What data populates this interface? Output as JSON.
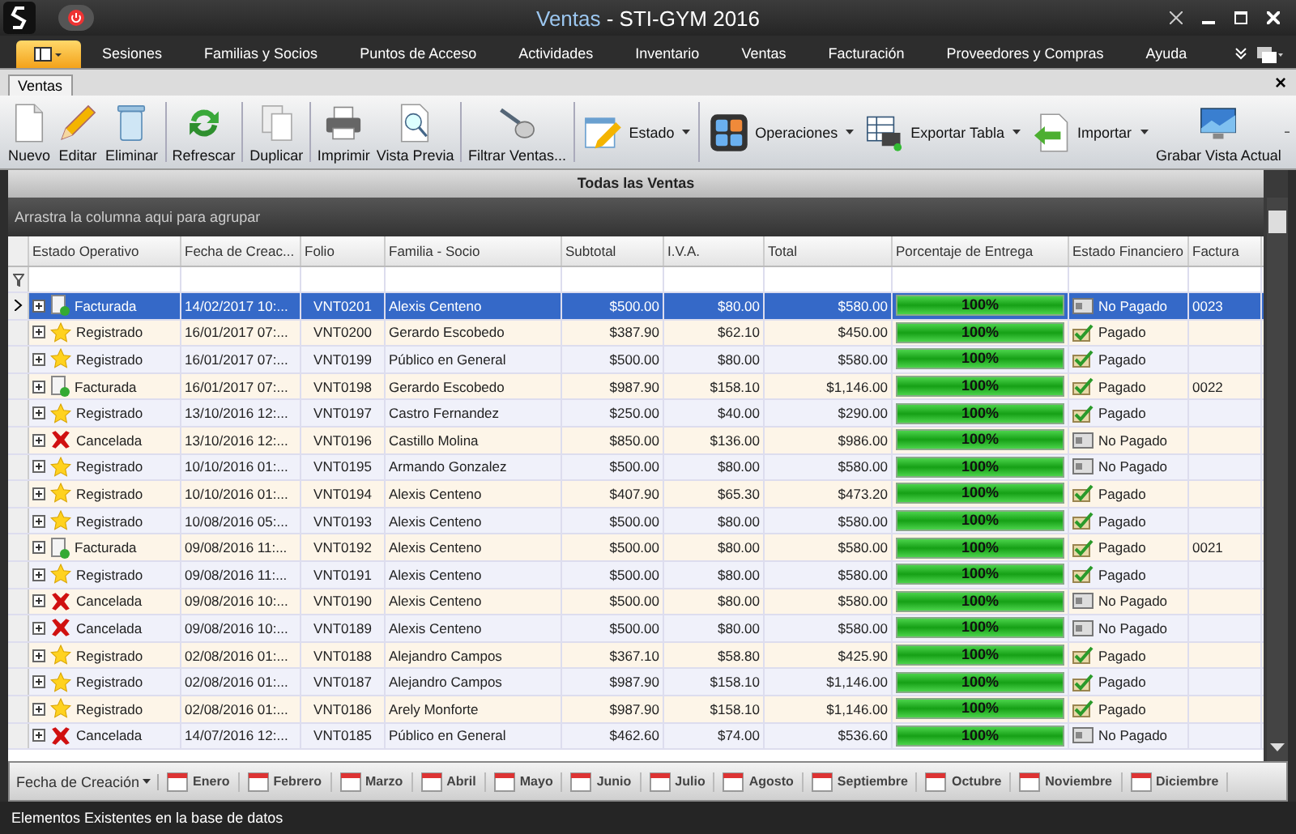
{
  "window": {
    "title_app": "Ventas",
    "title_rest": " - STI-GYM 2016"
  },
  "ribbon_tabs": [
    {
      "label": "Sesiones",
      "selected": false
    },
    {
      "label": "Familias y Socios",
      "selected": false
    },
    {
      "label": "Puntos de Acceso",
      "selected": false
    },
    {
      "label": "Actividades",
      "selected": false
    },
    {
      "label": "Inventario",
      "selected": false
    },
    {
      "label": "Ventas",
      "selected": false
    },
    {
      "label": "Facturación",
      "selected": false
    },
    {
      "label": "Proveedores y Compras",
      "selected": false
    },
    {
      "label": "Ayuda",
      "selected": false
    }
  ],
  "document_tab": {
    "label": "Ventas",
    "close": "×"
  },
  "toolbar": [
    {
      "label": "Nuevo",
      "kind": "large"
    },
    {
      "label": "Editar",
      "kind": "large"
    },
    {
      "label": "Eliminar",
      "kind": "large"
    },
    {
      "label": "Refrescar",
      "kind": "large"
    },
    {
      "label": "Duplicar",
      "kind": "large"
    },
    {
      "label": "Imprimir",
      "kind": "large"
    },
    {
      "label": "Vista Previa",
      "kind": "large"
    },
    {
      "label": "Filtrar Ventas...",
      "kind": "large"
    },
    {
      "label": "Estado",
      "kind": "dropdown"
    },
    {
      "label": "Operaciones",
      "kind": "dropdown"
    },
    {
      "label": "Exportar Tabla",
      "kind": "dropdown"
    },
    {
      "label": "Importar",
      "kind": "dropdown"
    },
    {
      "label": "Grabar Vista Actual",
      "kind": "large"
    }
  ],
  "panel_title": "Todas las Ventas",
  "group_hint": "Arrastra la columna aqui para agrupar",
  "table": {
    "columns": [
      "Estado Operativo",
      "Fecha de Creac...",
      "Folio",
      "Familia - Socio",
      "Subtotal",
      "I.V.A.",
      "Total",
      "Porcentaje de Entrega",
      "Estado Financiero",
      "Factura"
    ],
    "rows": [
      {
        "selected": true,
        "status": {
          "kind": "facturada",
          "label": "Facturada"
        },
        "fecha": "14/02/2017 10:...",
        "folio": "VNT0201",
        "socio": "Alexis Centeno",
        "subtotal": "$500.00",
        "iva": "$80.00",
        "total": "$580.00",
        "level": 1,
        "porcentaje": "100%",
        "financiero": {
          "kind": "no_pagado",
          "label": "No Pagado"
        },
        "factura": "0023"
      },
      {
        "selected": false,
        "status": {
          "kind": "registrado",
          "label": "Registrado"
        },
        "fecha": "16/01/2017 07:...",
        "folio": "VNT0200",
        "socio": "Gerardo Escobedo",
        "subtotal": "$387.90",
        "iva": "$62.10",
        "total": "$450.00",
        "level": 1,
        "porcentaje": "100%",
        "financiero": {
          "kind": "pagado",
          "label": "Pagado"
        }
      },
      {
        "selected": false,
        "status": {
          "kind": "registrado",
          "label": "Registrado"
        },
        "fecha": "16/01/2017 07:...",
        "folio": "VNT0199",
        "socio": "Público en General",
        "subtotal": "$500.00",
        "iva": "$80.00",
        "total": "$580.00",
        "level": 1,
        "porcentaje": "100%",
        "financiero": {
          "kind": "pagado",
          "label": "Pagado"
        }
      },
      {
        "selected": false,
        "status": {
          "kind": "facturada",
          "label": "Facturada"
        },
        "fecha": "16/01/2017 07:...",
        "folio": "VNT0198",
        "socio": "Gerardo Escobedo",
        "subtotal": "$987.90",
        "iva": "$158.10",
        "total": "$1,146.00",
        "level": 1,
        "porcentaje": "100%",
        "financiero": {
          "kind": "pagado",
          "label": "Pagado"
        },
        "factura": "0022"
      },
      {
        "selected": false,
        "status": {
          "kind": "registrado",
          "label": "Registrado"
        },
        "fecha": "13/10/2016 12:...",
        "folio": "VNT0197",
        "socio": "Castro Fernandez",
        "subtotal": "$250.00",
        "iva": "$40.00",
        "total": "$290.00",
        "level": 1,
        "porcentaje": "100%",
        "financiero": {
          "kind": "pagado",
          "label": "Pagado"
        }
      },
      {
        "selected": false,
        "status": {
          "kind": "cancelada",
          "label": "Cancelada"
        },
        "fecha": "13/10/2016 12:...",
        "folio": "VNT0196",
        "socio": "Castillo Molina",
        "subtotal": "$850.00",
        "iva": "$136.00",
        "total": "$986.00",
        "level": 1,
        "porcentaje": "100%",
        "financiero": {
          "kind": "no_pagado",
          "label": "No Pagado"
        }
      },
      {
        "selected": false,
        "status": {
          "kind": "registrado",
          "label": "Registrado"
        },
        "fecha": "10/10/2016 01:...",
        "folio": "VNT0195",
        "socio": "Armando Gonzalez",
        "subtotal": "$500.00",
        "iva": "$80.00",
        "total": "$580.00",
        "level": 1,
        "porcentaje": "100%",
        "financiero": {
          "kind": "no_pagado",
          "label": "No Pagado"
        }
      },
      {
        "selected": false,
        "status": {
          "kind": "registrado",
          "label": "Registrado"
        },
        "fecha": "10/10/2016 01:...",
        "folio": "VNT0194",
        "socio": "Alexis Centeno",
        "subtotal": "$407.90",
        "iva": "$65.30",
        "total": "$473.20",
        "level": 1,
        "porcentaje": "100%",
        "financiero": {
          "kind": "pagado",
          "label": "Pagado"
        }
      },
      {
        "selected": false,
        "status": {
          "kind": "registrado",
          "label": "Registrado"
        },
        "fecha": "10/08/2016 05:...",
        "folio": "VNT0193",
        "socio": "Alexis Centeno",
        "subtotal": "$500.00",
        "iva": "$80.00",
        "total": "$580.00",
        "level": 1,
        "porcentaje": "100%",
        "financiero": {
          "kind": "pagado",
          "label": "Pagado"
        }
      },
      {
        "selected": false,
        "status": {
          "kind": "facturada",
          "label": "Facturada"
        },
        "fecha": "09/08/2016 11:...",
        "folio": "VNT0192",
        "socio": "Alexis Centeno",
        "subtotal": "$500.00",
        "iva": "$80.00",
        "total": "$580.00",
        "level": 1,
        "porcentaje": "100%",
        "financiero": {
          "kind": "pagado",
          "label": "Pagado"
        },
        "factura": "0021"
      },
      {
        "selected": false,
        "status": {
          "kind": "registrado",
          "label": "Registrado"
        },
        "fecha": "09/08/2016 11:...",
        "folio": "VNT0191",
        "socio": "Alexis Centeno",
        "subtotal": "$500.00",
        "iva": "$80.00",
        "total": "$580.00",
        "level": 1,
        "porcentaje": "100%",
        "financiero": {
          "kind": "pagado",
          "label": "Pagado"
        }
      },
      {
        "selected": false,
        "status": {
          "kind": "cancelada",
          "label": "Cancelada"
        },
        "fecha": "09/08/2016 10:...",
        "folio": "VNT0190",
        "socio": "Alexis Centeno",
        "subtotal": "$500.00",
        "iva": "$80.00",
        "total": "$580.00",
        "level": 1,
        "porcentaje": "100%",
        "financiero": {
          "kind": "no_pagado",
          "label": "No Pagado"
        }
      },
      {
        "selected": false,
        "status": {
          "kind": "cancelada",
          "label": "Cancelada"
        },
        "fecha": "09/08/2016 10:...",
        "folio": "VNT0189",
        "socio": "Alexis Centeno",
        "subtotal": "$500.00",
        "iva": "$80.00",
        "total": "$580.00",
        "level": 1,
        "porcentaje": "100%",
        "financiero": {
          "kind": "no_pagado",
          "label": "No Pagado"
        }
      },
      {
        "selected": false,
        "status": {
          "kind": "registrado",
          "label": "Registrado"
        },
        "fecha": "02/08/2016 01:...",
        "folio": "VNT0188",
        "socio": "Alejandro Campos",
        "subtotal": "$367.10",
        "iva": "$58.80",
        "total": "$425.90",
        "level": 1,
        "porcentaje": "100%",
        "financiero": {
          "kind": "pagado",
          "label": "Pagado"
        }
      },
      {
        "selected": false,
        "status": {
          "kind": "registrado",
          "label": "Registrado"
        },
        "fecha": "02/08/2016 01:...",
        "folio": "VNT0187",
        "socio": "Alejandro Campos",
        "subtotal": "$987.90",
        "iva": "$158.10",
        "total": "$1,146.00",
        "level": 1,
        "porcentaje": "100%",
        "financiero": {
          "kind": "pagado",
          "label": "Pagado"
        }
      },
      {
        "selected": false,
        "status": {
          "kind": "registrado",
          "label": "Registrado"
        },
        "fecha": "02/08/2016 01:...",
        "folio": "VNT0186",
        "socio": "Arely Monforte",
        "subtotal": "$987.90",
        "iva": "$158.10",
        "total": "$1,146.00",
        "level": 1,
        "porcentaje": "100%",
        "financiero": {
          "kind": "pagado",
          "label": "Pagado"
        }
      },
      {
        "selected": false,
        "status": {
          "kind": "cancelada",
          "label": "Cancelada"
        },
        "fecha": "14/07/2016 12:...",
        "folio": "VNT0185",
        "socio": "Público en General",
        "subtotal": "$462.60",
        "iva": "$74.00",
        "total": "$536.60",
        "level": 1,
        "porcentaje": "100%",
        "financiero": {
          "kind": "no_pagado",
          "label": "No Pagado"
        }
      }
    ]
  },
  "date_filter": {
    "label": "Fecha de Creación",
    "months": [
      "Enero",
      "Febrero",
      "Marzo",
      "Abril",
      "Mayo",
      "Junio",
      "Julio",
      "Agosto",
      "Septiembre",
      "Octubre",
      "Noviembre",
      "Diciembre"
    ]
  },
  "status_bar": "Elementos Existentes en la base de datos"
}
